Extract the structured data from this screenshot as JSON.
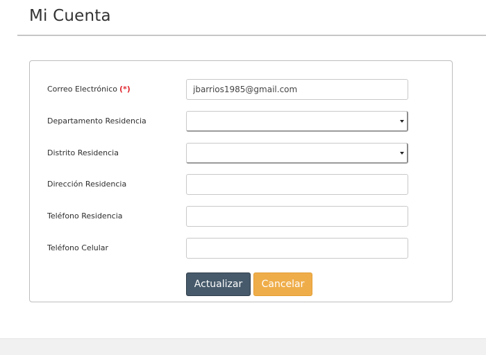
{
  "page": {
    "title": "Mi Cuenta"
  },
  "form": {
    "fields": [
      {
        "label": "Correo Electrónico",
        "required_marker": "(*)",
        "type": "text",
        "value": "jbarrios1985@gmail.com"
      },
      {
        "label": "Departamento Residencia",
        "type": "select",
        "value": ""
      },
      {
        "label": "Distrito Residencia",
        "type": "select",
        "value": ""
      },
      {
        "label": "Dirección Residencia",
        "type": "text",
        "value": ""
      },
      {
        "label": "Teléfono Residencia",
        "type": "text",
        "value": ""
      },
      {
        "label": "Teléfono Celular",
        "type": "text",
        "value": ""
      }
    ],
    "buttons": {
      "submit_label": "Actualizar",
      "cancel_label": "Cancelar"
    }
  },
  "colors": {
    "primary_button": "#465a6b",
    "cancel_button": "#efad4a",
    "required_marker": "#e0282f"
  }
}
